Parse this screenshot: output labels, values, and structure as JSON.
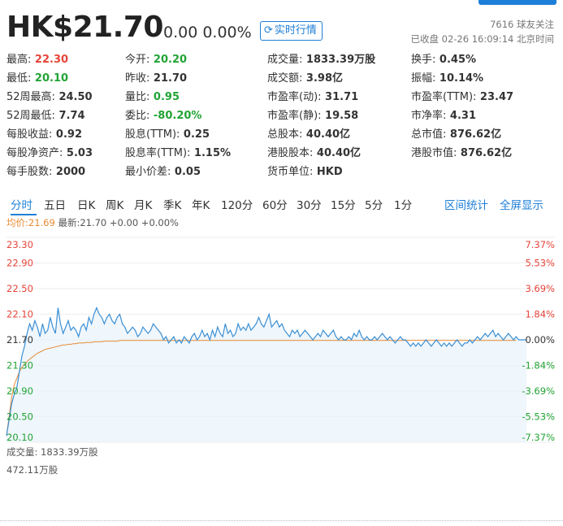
{
  "header": {
    "price": "HK$21.70",
    "change": "0.00 0.00%",
    "realtime_label": "实时行情",
    "followers": "7616 球友关注",
    "status": "已收盘 02-26 16:09:14 北京时间"
  },
  "stats": [
    {
      "label": "最高:",
      "value": "22.30",
      "color": "red"
    },
    {
      "label": "今开:",
      "value": "20.20",
      "color": "green"
    },
    {
      "label": "成交量:",
      "value": "1833.39万股",
      "color": ""
    },
    {
      "label": "换手:",
      "value": "0.45%",
      "color": ""
    },
    {
      "label": "最低:",
      "value": "20.10",
      "color": "green"
    },
    {
      "label": "昨收:",
      "value": "21.70",
      "color": ""
    },
    {
      "label": "成交额:",
      "value": "3.98亿",
      "color": ""
    },
    {
      "label": "振幅:",
      "value": "10.14%",
      "color": ""
    },
    {
      "label": "52周最高:",
      "value": "24.50",
      "color": ""
    },
    {
      "label": "量比:",
      "value": "0.95",
      "color": "green"
    },
    {
      "label": "市盈率(动):",
      "value": "31.71",
      "color": ""
    },
    {
      "label": "市盈率(TTM):",
      "value": "23.47",
      "color": ""
    },
    {
      "label": "52周最低:",
      "value": "7.74",
      "color": ""
    },
    {
      "label": "委比:",
      "value": "-80.20%",
      "color": "green"
    },
    {
      "label": "市盈率(静):",
      "value": "19.58",
      "color": ""
    },
    {
      "label": "市净率:",
      "value": "4.31",
      "color": ""
    },
    {
      "label": "每股收益:",
      "value": "0.92",
      "color": ""
    },
    {
      "label": "股息(TTM):",
      "value": "0.25",
      "color": ""
    },
    {
      "label": "总股本:",
      "value": "40.40亿",
      "color": ""
    },
    {
      "label": "总市值:",
      "value": "876.62亿",
      "color": ""
    },
    {
      "label": "每股净资产:",
      "value": "5.03",
      "color": ""
    },
    {
      "label": "股息率(TTM):",
      "value": "1.15%",
      "color": ""
    },
    {
      "label": "港股股本:",
      "value": "40.40亿",
      "color": ""
    },
    {
      "label": "港股市值:",
      "value": "876.62亿",
      "color": ""
    },
    {
      "label": "每手股数:",
      "value": "2000",
      "color": ""
    },
    {
      "label": "最小价差:",
      "value": "0.05",
      "color": ""
    },
    {
      "label": "货币单位:",
      "value": "HKD",
      "color": ""
    }
  ],
  "tabs": [
    "分时",
    "五日",
    "日K",
    "周K",
    "月K",
    "季K",
    "年K",
    "120分",
    "60分",
    "30分",
    "15分",
    "5分",
    "1分"
  ],
  "tab_links": [
    "区间统计",
    "全屏显示"
  ],
  "avg_label": "均价:21.69",
  "latest_label": "最新:21.70 +0.00 +0.00%",
  "volume_label": "成交量: 1833.39万股",
  "volume_max": "472.11万股",
  "colors": {
    "price_line": "#3b8fd4",
    "avg_line": "#e88b32",
    "fill": "#e8f2fb",
    "up": "#e6443a",
    "down": "#22a335",
    "accent": "#1e7fd8"
  },
  "chart_data": {
    "type": "line",
    "title": "",
    "xlabel": "",
    "ylabel": "",
    "ylim": [
      20.1,
      23.3
    ],
    "y_ticks": [
      "23.30",
      "22.90",
      "22.50",
      "22.10",
      "21.70",
      "21.30",
      "20.90",
      "20.50",
      "20.10"
    ],
    "y_tick_values": [
      23.3,
      22.9,
      22.5,
      22.1,
      21.7,
      21.3,
      20.9,
      20.5,
      20.1
    ],
    "pct_ticks": [
      "7.37%",
      "5.53%",
      "3.69%",
      "1.84%",
      "0.00%",
      "-1.84%",
      "-3.69%",
      "-5.53%",
      "-7.37%"
    ],
    "series": [
      {
        "values": [
          20.2,
          20.45,
          20.7,
          20.85,
          20.95,
          21.2,
          21.45,
          21.6,
          21.8,
          21.95,
          21.85,
          22.0,
          21.9,
          21.75,
          21.95,
          21.8,
          21.85,
          22.05,
          21.9,
          21.8,
          22.2,
          21.95,
          21.8,
          21.9,
          22.0,
          21.85,
          21.9,
          21.85,
          21.75,
          21.9,
          21.95,
          21.85,
          22.05,
          21.95,
          22.1,
          22.2,
          22.1,
          22.05,
          21.95,
          22.05,
          22.1,
          22.0,
          21.95,
          22.05,
          22.1,
          21.95,
          21.9,
          21.8,
          21.85,
          21.9,
          21.85,
          21.75,
          21.8,
          21.9,
          21.85,
          21.8,
          21.85,
          21.95,
          21.9,
          21.85,
          21.8,
          21.7,
          21.75,
          21.65,
          21.7,
          21.75,
          21.65,
          21.7,
          21.65,
          21.75,
          21.7,
          21.65,
          21.75,
          21.8,
          21.7,
          21.75,
          21.85,
          21.75,
          21.8,
          21.7,
          21.85,
          21.75,
          21.9,
          21.8,
          21.75,
          21.95,
          21.8,
          21.85,
          21.75,
          21.8,
          21.95,
          21.85,
          21.9,
          21.85,
          21.95,
          21.85,
          21.9,
          21.95,
          22.05,
          21.95,
          21.9,
          22.0,
          22.1,
          21.9,
          21.95,
          22.0,
          21.9,
          21.95,
          21.85,
          21.8,
          21.75,
          21.85,
          21.8,
          21.85,
          21.75,
          21.8,
          21.85,
          21.8,
          21.75,
          21.7,
          21.75,
          21.8,
          21.75,
          21.85,
          21.8,
          21.75,
          21.8,
          21.85,
          21.75,
          21.7,
          21.75,
          21.7,
          21.7,
          21.75,
          21.7,
          21.8,
          21.75,
          21.85,
          21.75,
          21.7,
          21.75,
          21.7,
          21.7,
          21.75,
          21.7,
          21.75,
          21.8,
          21.75,
          21.7,
          21.75,
          21.7,
          21.65,
          21.7,
          21.75,
          21.7,
          21.7,
          21.65,
          21.6,
          21.65,
          21.6,
          21.65,
          21.6,
          21.65,
          21.7,
          21.65,
          21.6,
          21.65,
          21.7,
          21.65,
          21.6,
          21.65,
          21.6,
          21.65,
          21.6,
          21.65,
          21.7,
          21.65,
          21.6,
          21.65,
          21.65,
          21.7,
          21.65,
          21.7,
          21.75,
          21.7,
          21.75,
          21.8,
          21.75,
          21.8,
          21.85,
          21.75,
          21.8,
          21.75,
          21.7,
          21.75,
          21.8,
          21.75,
          21.7,
          21.75,
          21.7,
          21.7,
          21.7,
          21.7
        ]
      },
      {
        "values": [
          20.2,
          20.5,
          20.8,
          21.0,
          21.1,
          21.2,
          21.27,
          21.32,
          21.36,
          21.4,
          21.43,
          21.46,
          21.49,
          21.51,
          21.53,
          21.55,
          21.56,
          21.57,
          21.58,
          21.59,
          21.6,
          21.61,
          21.62,
          21.62,
          21.63,
          21.63,
          21.64,
          21.64,
          21.65,
          21.65,
          21.65,
          21.66,
          21.66,
          21.66,
          21.67,
          21.67,
          21.67,
          21.67,
          21.68,
          21.68,
          21.68,
          21.68,
          21.68,
          21.68,
          21.69,
          21.69,
          21.69,
          21.69,
          21.69,
          21.69,
          21.69,
          21.69,
          21.69,
          21.69,
          21.69,
          21.69,
          21.69,
          21.69,
          21.69,
          21.69,
          21.69,
          21.69,
          21.69,
          21.69,
          21.69,
          21.69,
          21.69,
          21.69,
          21.69,
          21.69,
          21.69,
          21.69,
          21.69,
          21.69,
          21.69,
          21.69,
          21.69,
          21.69,
          21.69,
          21.69,
          21.69,
          21.69,
          21.69,
          21.69,
          21.69,
          21.69,
          21.69,
          21.69,
          21.69,
          21.69,
          21.69,
          21.69,
          21.69,
          21.69,
          21.69,
          21.69,
          21.69,
          21.69,
          21.69,
          21.69,
          21.69,
          21.69,
          21.69,
          21.69,
          21.69,
          21.69,
          21.69,
          21.69,
          21.69,
          21.69,
          21.69,
          21.69,
          21.69,
          21.69,
          21.69,
          21.69,
          21.69,
          21.69,
          21.69,
          21.69,
          21.69,
          21.69,
          21.69,
          21.69,
          21.69,
          21.69,
          21.69,
          21.69,
          21.69,
          21.69,
          21.69,
          21.69,
          21.69,
          21.69,
          21.69,
          21.69,
          21.69,
          21.69,
          21.69,
          21.69,
          21.69,
          21.69,
          21.69,
          21.69,
          21.69,
          21.69,
          21.69,
          21.69,
          21.69,
          21.69,
          21.69,
          21.69,
          21.69,
          21.69,
          21.69,
          21.69,
          21.69,
          21.69,
          21.69,
          21.69,
          21.69,
          21.69,
          21.69,
          21.69,
          21.69,
          21.69,
          21.69,
          21.69,
          21.69,
          21.69,
          21.69,
          21.69,
          21.69,
          21.69,
          21.69,
          21.69,
          21.69,
          21.69,
          21.69,
          21.69,
          21.69,
          21.69,
          21.69,
          21.69,
          21.69,
          21.69,
          21.69,
          21.69,
          21.69,
          21.69,
          21.69,
          21.69,
          21.69,
          21.69,
          21.69,
          21.69,
          21.69,
          21.69,
          21.69
        ]
      }
    ],
    "grid": true
  }
}
